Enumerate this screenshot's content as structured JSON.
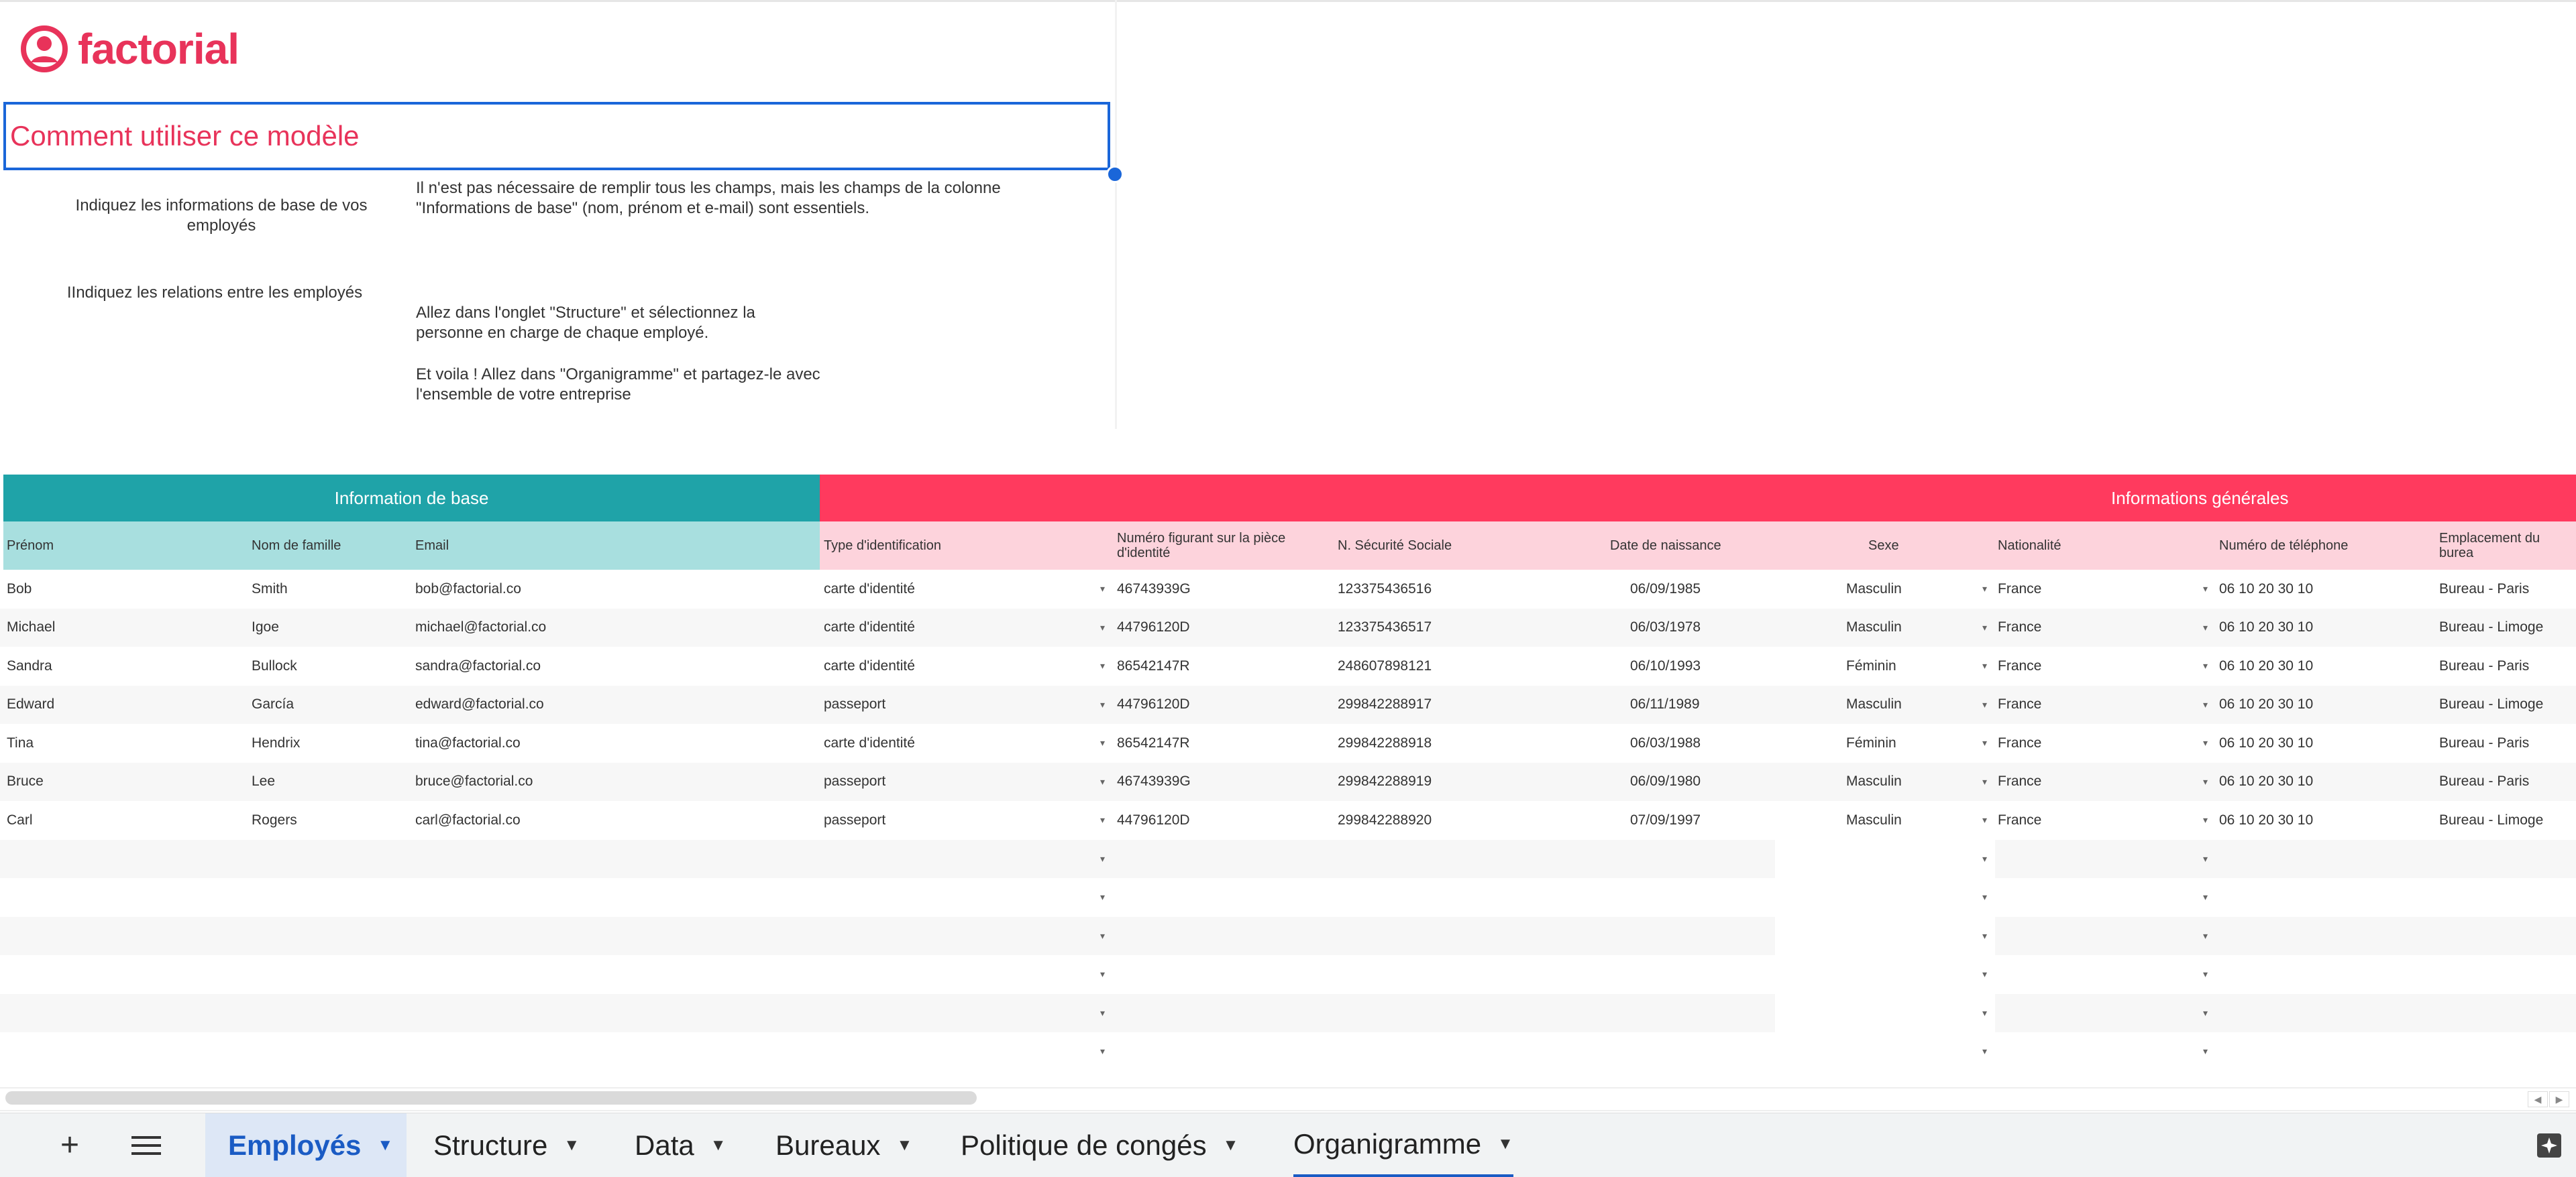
{
  "logo": {
    "text": "factorial"
  },
  "guide": {
    "title": "Comment utiliser ce modèle",
    "step1_label": "Indiquez les informations de base de vos employés",
    "step1_text": "Il n'est pas nécessaire de remplir tous les champs, mais les champs de la colonne \"Informations de base\" (nom, prénom et e-mail) sont essentiels.",
    "step2_label": "IIndiquez les relations entre les employés",
    "step2_text_a": "Allez dans l'onglet \"Structure\" et sélectionnez la personne en charge de chaque employé.",
    "step2_text_b": "Et voila ! Allez dans \"Organigramme\" et partagez-le avec l'ensemble de votre entreprise"
  },
  "table": {
    "band_basic": "Information de base",
    "band_general": "Informations générales",
    "headers": {
      "prenom": "Prénom",
      "nom": "Nom de famille",
      "email": "Email",
      "type_id": "Type d'identification",
      "numero_l1": "Numéro figurant sur la pièce",
      "numero_l2": "d'identité",
      "secu": "N. Sécurité Sociale",
      "naissance": "Date de naissance",
      "sexe": "Sexe",
      "nationalite": "Nationalité",
      "telephone": "Numéro de téléphone",
      "bureau": "Emplacement du burea"
    },
    "rows": [
      {
        "prenom": "Bob",
        "nom": "Smith",
        "email": "bob@factorial.co",
        "type_id": "carte d'identité",
        "numero": "46743939G",
        "secu": "123375436516",
        "naissance": "06/09/1985",
        "sexe": "Masculin",
        "nationalite": "France",
        "telephone": "06 10 20 30 10",
        "bureau": "Bureau - Paris"
      },
      {
        "prenom": "Michael",
        "nom": "Igoe",
        "email": "michael@factorial.co",
        "type_id": "carte d'identité",
        "numero": "44796120D",
        "secu": "123375436517",
        "naissance": "06/03/1978",
        "sexe": "Masculin",
        "nationalite": "France",
        "telephone": "06 10 20 30 10",
        "bureau": "Bureau - Limoge"
      },
      {
        "prenom": "Sandra",
        "nom": "Bullock",
        "email": "sandra@factorial.co",
        "type_id": "carte d'identité",
        "numero": "86542147R",
        "secu": "248607898121",
        "naissance": "06/10/1993",
        "sexe": "Féminin",
        "nationalite": "France",
        "telephone": "06 10 20 30 10",
        "bureau": "Bureau - Paris"
      },
      {
        "prenom": "Edward",
        "nom": "García",
        "email": "edward@factorial.co",
        "type_id": "passeport",
        "numero": "44796120D",
        "secu": "299842288917",
        "naissance": "06/11/1989",
        "sexe": "Masculin",
        "nationalite": "France",
        "telephone": "06 10 20 30 10",
        "bureau": "Bureau - Limoge"
      },
      {
        "prenom": "Tina",
        "nom": "Hendrix",
        "email": "tina@factorial.co",
        "type_id": "carte d'identité",
        "numero": "86542147R",
        "secu": "299842288918",
        "naissance": "06/03/1988",
        "sexe": "Féminin",
        "nationalite": "France",
        "telephone": "06 10 20 30 10",
        "bureau": "Bureau - Paris"
      },
      {
        "prenom": "Bruce",
        "nom": "Lee",
        "email": "bruce@factorial.co",
        "type_id": "passeport",
        "numero": "46743939G",
        "secu": "299842288919",
        "naissance": "06/09/1980",
        "sexe": "Masculin",
        "nationalite": "France",
        "telephone": "06 10 20 30 10",
        "bureau": "Bureau - Paris"
      },
      {
        "prenom": "Carl",
        "nom": "Rogers",
        "email": "carl@factorial.co",
        "type_id": "passeport",
        "numero": "44796120D",
        "secu": "299842288920",
        "naissance": "07/09/1997",
        "sexe": "Masculin",
        "nationalite": "France",
        "telephone": "06 10 20 30 10",
        "bureau": "Bureau - Limoge"
      }
    ]
  },
  "sheet_tabs": [
    {
      "label": "Employés",
      "active": true
    },
    {
      "label": "Structure",
      "active": false
    },
    {
      "label": "Data",
      "active": false
    },
    {
      "label": "Bureaux",
      "active": false
    },
    {
      "label": "Politique de congés",
      "active": false
    },
    {
      "label": "Organigramme",
      "active": false
    }
  ],
  "icons": {
    "add_sheet": "plus-icon",
    "all_sheets": "menu-icon",
    "explore": "explore-icon",
    "tab_menu": "caret-down-icon"
  },
  "colors": {
    "brand": "#e8335a",
    "teal": "#1fa3a8",
    "teal_light": "#a8dfdf",
    "red": "#ff3a5e",
    "pink_light": "#fdd3dc",
    "selection": "#1a66d9"
  }
}
